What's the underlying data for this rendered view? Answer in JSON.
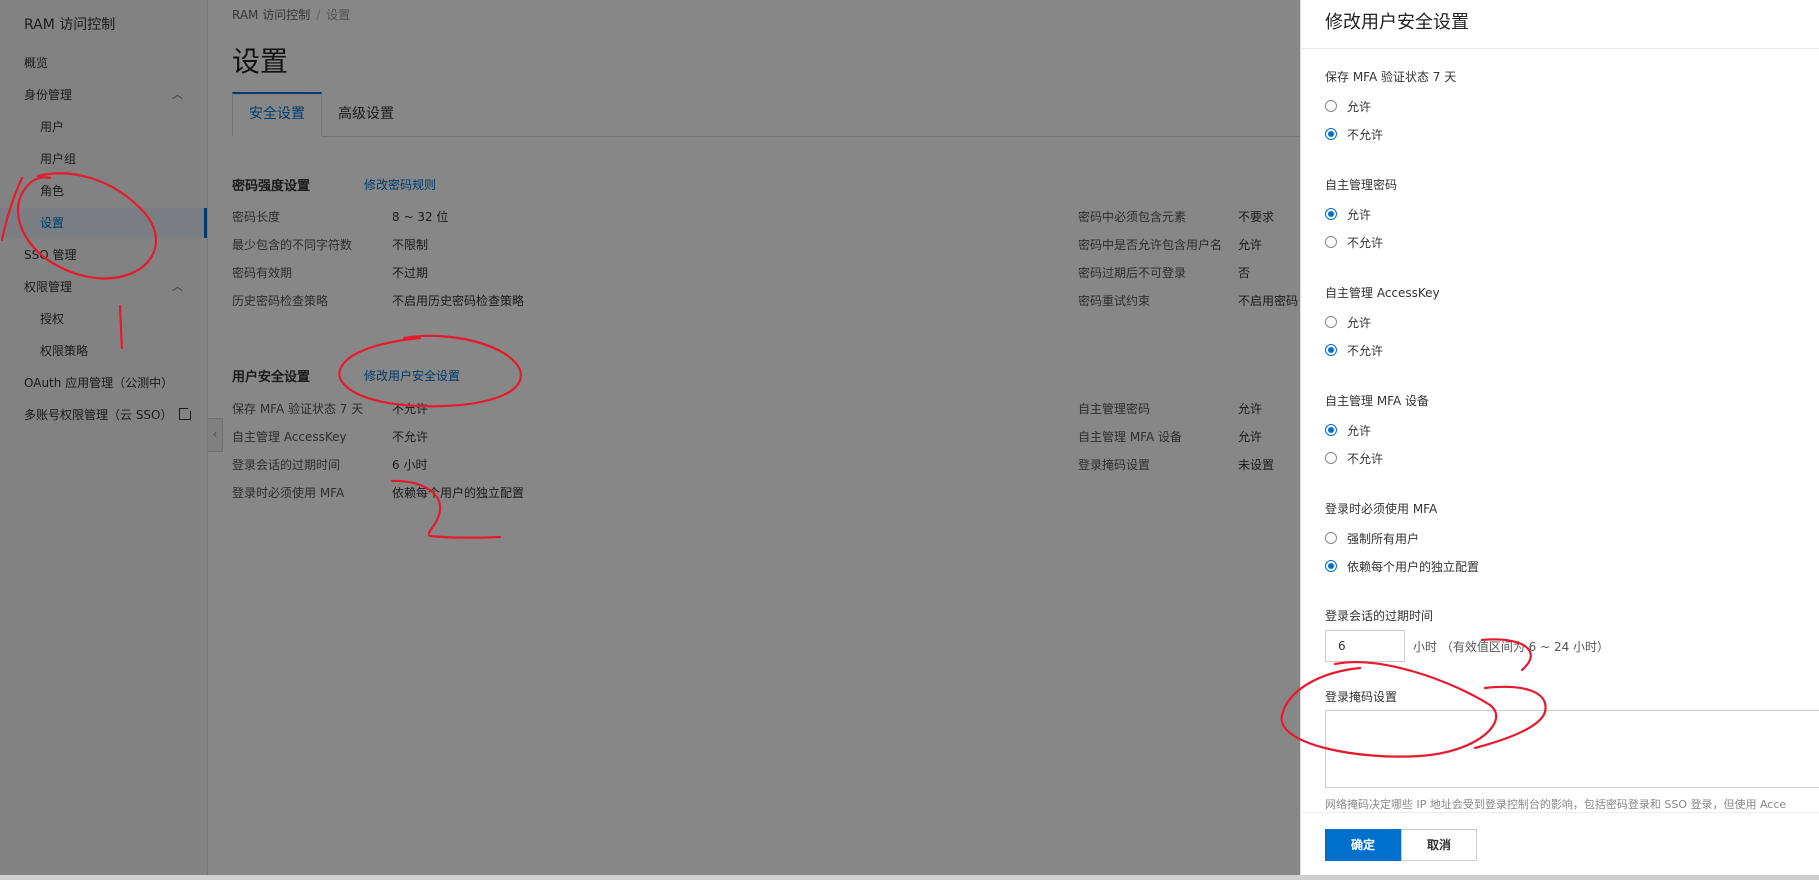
{
  "sidebar": {
    "brand": "RAM 访问控制",
    "items": [
      {
        "label": "概览"
      },
      {
        "label": "身份管理"
      },
      {
        "label": "用户"
      },
      {
        "label": "用户组"
      },
      {
        "label": "角色"
      },
      {
        "label": "设置"
      },
      {
        "label": "SSO 管理"
      },
      {
        "label": "权限管理"
      },
      {
        "label": "授权"
      },
      {
        "label": "权限策略"
      },
      {
        "label": "OAuth 应用管理（公测中）"
      },
      {
        "label": "多账号权限管理（云 SSO）"
      }
    ]
  },
  "breadcrumb": {
    "root": "RAM 访问控制",
    "sep": "/",
    "current": "设置"
  },
  "page_title": "设置",
  "tabs": [
    {
      "label": "安全设置"
    },
    {
      "label": "高级设置"
    }
  ],
  "password_section": {
    "title": "密码强度设置",
    "link": "修改密码规则",
    "left": [
      {
        "label": "密码长度",
        "value": "8 ~ 32 位"
      },
      {
        "label": "最少包含的不同字符数",
        "value": "不限制"
      },
      {
        "label": "密码有效期",
        "value": "不过期"
      },
      {
        "label": "历史密码检查策略",
        "value": "不启用历史密码检查策略"
      }
    ],
    "right": [
      {
        "label": "密码中必须包含元素",
        "value": "不要求"
      },
      {
        "label": "密码中是否允许包含用户名",
        "value": "允许"
      },
      {
        "label": "密码过期后不可登录",
        "value": "否"
      },
      {
        "label": "密码重试约束",
        "value": "不启用密码"
      }
    ]
  },
  "user_section": {
    "title": "用户安全设置",
    "link": "修改用户安全设置",
    "left": [
      {
        "label": "保存 MFA 验证状态 7 天",
        "value": "不允许"
      },
      {
        "label": "自主管理 AccessKey",
        "value": "不允许"
      },
      {
        "label": "登录会话的过期时间",
        "value": "6 小时"
      },
      {
        "label": "登录时必须使用 MFA",
        "value": "依赖每个用户的独立配置"
      }
    ],
    "right": [
      {
        "label": "自主管理密码",
        "value": "允许"
      },
      {
        "label": "自主管理 MFA 设备",
        "value": "允许"
      },
      {
        "label": "登录掩码设置",
        "value": "未设置"
      }
    ]
  },
  "drawer": {
    "title": "修改用户安全设置",
    "fields": [
      {
        "label": "保存 MFA 验证状态 7 天",
        "options": [
          "允许",
          "不允许"
        ],
        "selected": 1
      },
      {
        "label": "自主管理密码",
        "options": [
          "允许",
          "不允许"
        ],
        "selected": 0
      },
      {
        "label": "自主管理 AccessKey",
        "options": [
          "允许",
          "不允许"
        ],
        "selected": 1
      },
      {
        "label": "自主管理 MFA 设备",
        "options": [
          "允许",
          "不允许"
        ],
        "selected": 0
      },
      {
        "label": "登录时必须使用 MFA",
        "options": [
          "强制所有用户",
          "依赖每个用户的独立配置"
        ],
        "selected": 1
      }
    ],
    "session": {
      "label": "登录会话的过期时间",
      "value": "6",
      "hint": "小时 （有效值区间为 6 ~ 24 小时）"
    },
    "mask": {
      "label": "登录掩码设置",
      "help": "网络掩码决定哪些 IP 地址会受到登录控制台的影响，包括密码登录和 SSO 登录，但使用 Acce"
    },
    "ok_label": "确定",
    "cancel_label": "取消"
  },
  "colors": {
    "primary": "#0070cc",
    "annotation": "#e8192c"
  }
}
